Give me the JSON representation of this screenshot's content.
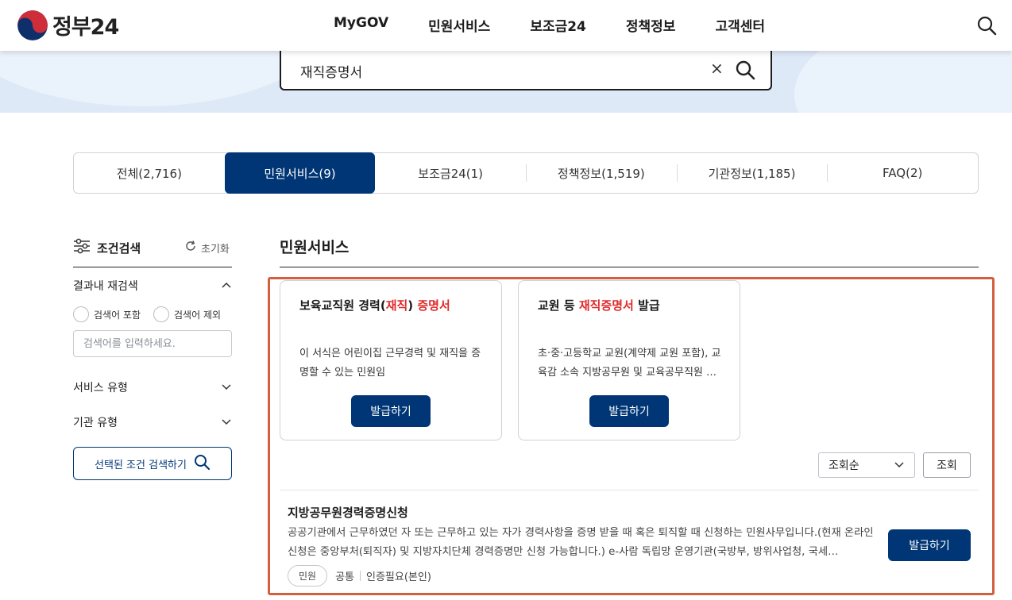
{
  "header": {
    "logo_text": "정부24",
    "nav": [
      "MyGOV",
      "민원서비스",
      "보조금24",
      "정책정보",
      "고객센터"
    ]
  },
  "search": {
    "value": "재직증명서",
    "clear_symbol": "×"
  },
  "tabs": [
    "전체(2,716)",
    "민원서비스(9)",
    "보조금24(1)",
    "정책정보(1,519)",
    "기관정보(1,185)",
    "FAQ(2)"
  ],
  "active_tab_index": 1,
  "sidebar": {
    "title": "조건검색",
    "reset_label": "초기화",
    "refine_label": "결과내 재검색",
    "radio_include": "검색어 포함",
    "radio_exclude": "검색어 제외",
    "input_placeholder": "검색어를 입력하세요.",
    "service_type_label": "서비스 유형",
    "agency_type_label": "기관 유형",
    "search_button": "선택된 조건 검색하기"
  },
  "main": {
    "section_title": "민원서비스",
    "cards": [
      {
        "title_pre": "보육교직원 경력(",
        "title_hl1": "재직",
        "title_mid": ") ",
        "title_hl2": "증명서",
        "title_post": "",
        "desc": "이 서식은 어린이집 근무경력 및 재직을 증명할 수 있는 민원임",
        "button": "발급하기"
      },
      {
        "title_pre": "교원 등 ",
        "title_hl1": "재직증명서",
        "title_mid": " 발급",
        "title_hl2": "",
        "title_post": "",
        "desc": "초·중·고등학교 교원(계약제 교원 포함), 교육감 소속 지방공무원 및 교육공무직원 …",
        "button": "발급하기"
      }
    ],
    "sort": {
      "selected": "조회순",
      "apply_button": "조회"
    },
    "list_item": {
      "title": "지방공무원경력증명신청",
      "desc": "공공기관에서 근무하였던 자 또는 근무하고 있는 자가 경력사항을 증명 받을 때 혹은 퇴직할 때 신청하는 민원사무입니다.(현재 온라인 신청은 중앙부처(퇴직자) 및 지방자치단체 경력증명만 신청 가능합니다.) e-사람 독립망 운영기관(국방부, 방위사업청, 국세…",
      "button": "발급하기",
      "badge": "민원",
      "meta1": "공통",
      "meta2": "인증필요(본인)"
    }
  },
  "colors": {
    "primary": "#003675",
    "highlight_text": "#e02a2a",
    "annotation_border": "#d2603f",
    "hero_bg": "#dde9f7"
  }
}
